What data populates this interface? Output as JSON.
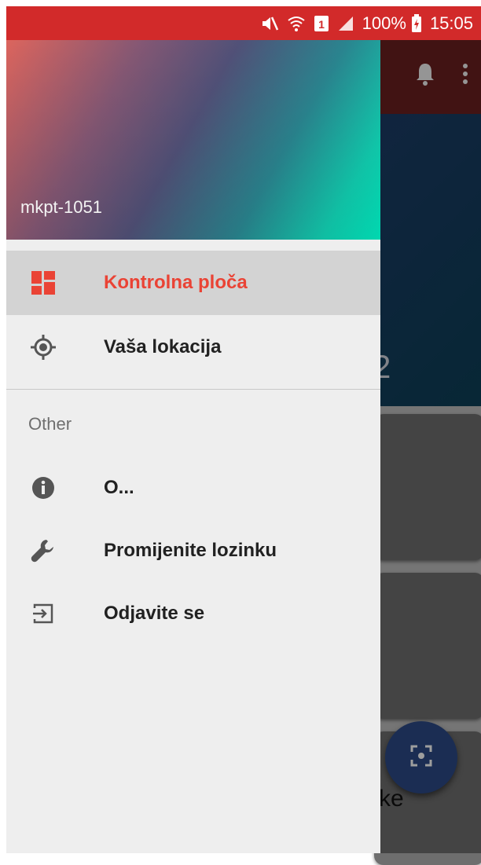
{
  "status_bar": {
    "battery": "100%",
    "time": "15:05",
    "sim_slot": "1"
  },
  "background_app": {
    "hero_partial_text": "2",
    "card_partial_text": "ke"
  },
  "drawer": {
    "account_name": "mkpt-1051",
    "main_items": [
      {
        "label": "Kontrolna ploča",
        "icon": "dashboard-icon",
        "active": true
      },
      {
        "label": "Vaša lokacija",
        "icon": "location-icon",
        "active": false
      }
    ],
    "section_header": "Other",
    "other_items": [
      {
        "label": "O...",
        "icon": "info-icon"
      },
      {
        "label": "Promijenite lozinku",
        "icon": "wrench-icon"
      },
      {
        "label": "Odjavite se",
        "icon": "logout-icon"
      }
    ]
  },
  "colors": {
    "status_bar": "#d22a2a",
    "accent": "#ea4335",
    "drawer_bg": "#eeeeee",
    "active_item_bg": "#d3d3d3"
  }
}
